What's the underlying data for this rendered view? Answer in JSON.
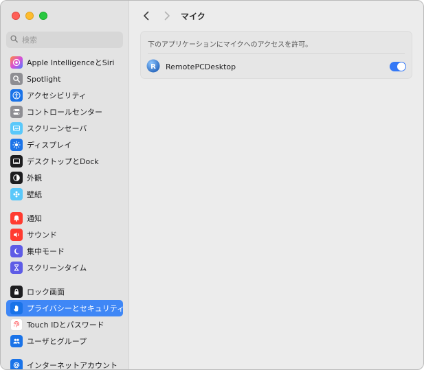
{
  "window": {
    "title": "マイク"
  },
  "search": {
    "placeholder": "検索"
  },
  "sidebar": {
    "items": [
      {
        "label": "Apple IntelligenceとSiri",
        "icon": "siri-icon",
        "color": "#b04fd6"
      },
      {
        "label": "Spotlight",
        "icon": "spotlight-icon",
        "color": "#8e8e93"
      },
      {
        "label": "アクセシビリティ",
        "icon": "accessibility-icon",
        "color": "#1a73e8"
      },
      {
        "label": "コントロールセンター",
        "icon": "control-center-icon",
        "color": "#8e8e93"
      },
      {
        "label": "スクリーンセーバ",
        "icon": "screensaver-icon",
        "color": "#5ac8fa"
      },
      {
        "label": "ディスプレイ",
        "icon": "display-icon",
        "color": "#1a73e8"
      },
      {
        "label": "デスクトップとDock",
        "icon": "desktop-dock-icon",
        "color": "#1d1d1f"
      },
      {
        "label": "外観",
        "icon": "appearance-icon",
        "color": "#1d1d1f"
      },
      {
        "label": "壁紙",
        "icon": "wallpaper-icon",
        "color": "#5ac8fa"
      },
      {
        "label": "通知",
        "icon": "notifications-icon",
        "color": "#ff3b30"
      },
      {
        "label": "サウンド",
        "icon": "sound-icon",
        "color": "#ff3b30"
      },
      {
        "label": "集中モード",
        "icon": "focus-icon",
        "color": "#5e5ce6"
      },
      {
        "label": "スクリーンタイム",
        "icon": "screen-time-icon",
        "color": "#5e5ce6"
      },
      {
        "label": "ロック画面",
        "icon": "lock-screen-icon",
        "color": "#1d1d1f"
      },
      {
        "label": "プライバシーとセキュリティ",
        "icon": "privacy-hand-icon",
        "color": "#1a73e8"
      },
      {
        "label": "Touch IDとパスワード",
        "icon": "fingerprint-icon",
        "color": "#ff6b6b"
      },
      {
        "label": "ユーザとグループ",
        "icon": "users-groups-icon",
        "color": "#1a73e8"
      },
      {
        "label": "インターネットアカウント",
        "icon": "internet-accounts-icon",
        "color": "#1a73e8"
      }
    ],
    "selected_index": 14
  },
  "panel": {
    "description": "下のアプリケーションにマイクへのアクセスを許可。",
    "apps": [
      {
        "name": "RemotePCDesktop",
        "enabled": true,
        "icon": "remotepc-icon"
      }
    ]
  },
  "colors": {
    "accent": "#3478f6",
    "selection": "#3f87f6"
  }
}
